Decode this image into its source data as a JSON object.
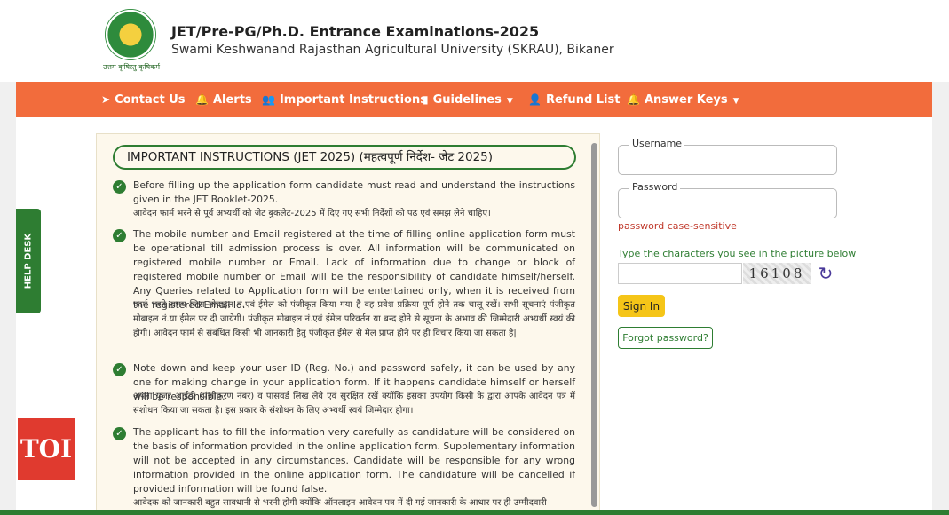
{
  "header": {
    "title": "JET/Pre-PG/Ph.D. Entrance Examinations-2025",
    "subtitle": "Swami Keshwanand Rajasthan Agricultural University (SKRAU), Bikaner",
    "logo_motto": "उत्तम कृषिस्तु कृषिकर्म"
  },
  "nav": {
    "items": [
      {
        "label": "Contact Us",
        "icon": "paper-plane-icon"
      },
      {
        "label": "Alerts",
        "icon": "bell-icon"
      },
      {
        "label": "Important Instructions",
        "icon": "users-icon"
      },
      {
        "label": "Guidelines",
        "icon": "bar-chart-icon"
      },
      {
        "label": "Refund List",
        "icon": "user-icon"
      },
      {
        "label": "Answer Keys",
        "icon": "bell-icon"
      }
    ]
  },
  "instructions": {
    "title": "IMPORTANT INSTRUCTIONS (JET 2025) (महत्वपूर्ण निर्देश- जेट 2025)",
    "items": [
      {
        "en": "Before filling up the application form candidate must read and understand the instructions given in the JET Booklet-2025.",
        "hi": "आवेदन फार्म भरने से पूर्व अभ्यर्थी को जेट बुकलेट-2025 में दिए गए सभी निर्देशों को पढ़ एवं समझ लेने चाहिए।"
      },
      {
        "en": "The mobile number and Email registered at the time of filling online application form must be operational till admission process is over. All information will be communicated on registered mobile number or Email. Lack of information due to change or block of registered mobile number or Email will be the responsibility of candidate himself/herself. Any Queries related to Application form will be entertained only, when it is received from the registered Email Id.",
        "hi": "फार्म भरते समय जिस मोबाइल नं.एवं ईमेल को पंजीकृत किया गया है वह प्रवेश प्रक्रिया पूर्ण होने तक चालू रखें। सभी सूचनाएं पंजीकृत मोबाइल नं.या ईमेल पर दी जायेगी। पंजीकृत मोबाइल नं.एवं ईमेल परिवर्तन या बन्द होने से सूचना के अभाव की जिम्मेदारी अभ्यर्थी स्वयं की होगी। आवेदन फार्म से संबंधित किसी भी जानकारी हेतु पंजीकृत ईमेल से मेल प्राप्त होने पर ही विचार किया जा सकता है|"
      },
      {
        "en": "Note down and keep your user ID (Reg. No.) and password safely, it can be used by any one for making change in your application form. If it happens candidate himself or herself will be responsible.",
        "hi": "अपना यूजर आईडी (पंजीकरण नंबर) व पासवर्ड लिख लेवे एवं सुरक्षित रखें क्योंकि इसका उपयोग किसी के द्वारा आपके आवेदन पत्र में संशोधन किया जा सकता है। इस प्रकार के संशोधन के लिए अभ्यर्थी स्वयं जिम्मेदार होगा।"
      },
      {
        "en": "The applicant has to fill the information very carefully as candidature will be considered on the basis of information provided in the online application form. Supplementary information will not be accepted in any circumstances. Candidate will be responsible for any wrong information provided in the online application form. The candidature will be cancelled if provided information will be found false.",
        "hi": "आवेदक को जानकारी बहुत सावधानी से भरनी होगी क्योंकि ऑनलाइन आवेदन पत्र में दी गई जानकारी के आधार पर ही उम्मीदवारी"
      }
    ]
  },
  "login": {
    "username_label": "Username",
    "password_label": "Password",
    "password_note": "password case-sensitive",
    "captcha_label": "Type the characters you see in the picture below",
    "captcha_text": "16108",
    "signin_label": "Sign In",
    "forgot_label": "Forgot password?"
  },
  "side": {
    "help_desk": "HELP DESK",
    "toi": "TOI"
  },
  "colors": {
    "nav_bg": "#f26c3c",
    "accent_green": "#2e7d32",
    "signin_yellow": "#f5c518",
    "note_red": "#c0392b"
  }
}
